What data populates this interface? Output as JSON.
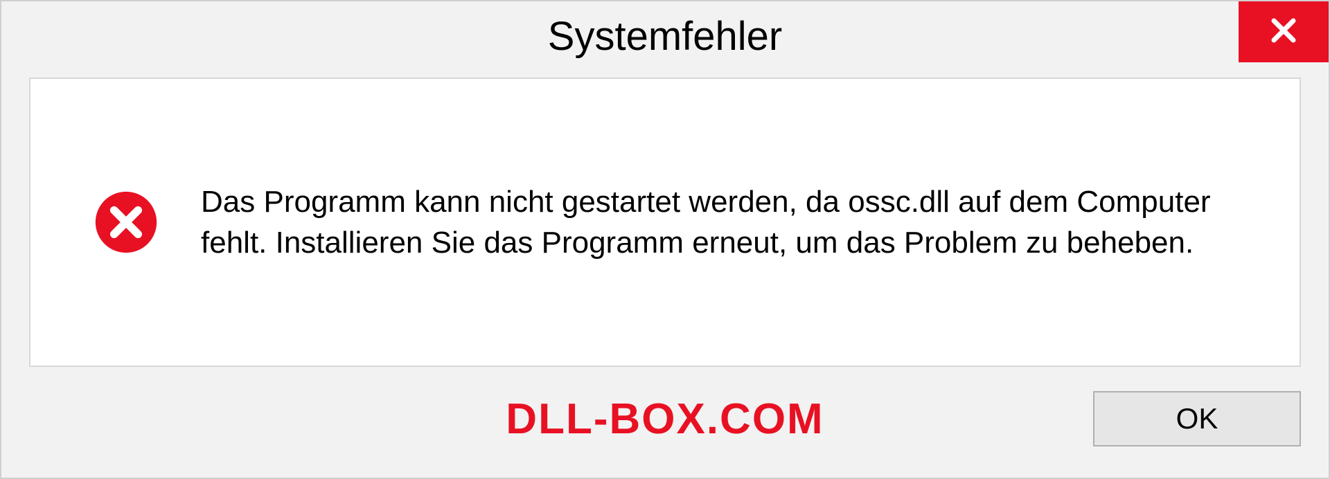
{
  "dialog": {
    "title": "Systemfehler",
    "message": "Das Programm kann nicht gestartet werden, da ossc.dll auf dem Computer fehlt. Installieren Sie das Programm erneut, um das Problem zu beheben.",
    "ok_label": "OK"
  },
  "watermark": "DLL-BOX.COM"
}
